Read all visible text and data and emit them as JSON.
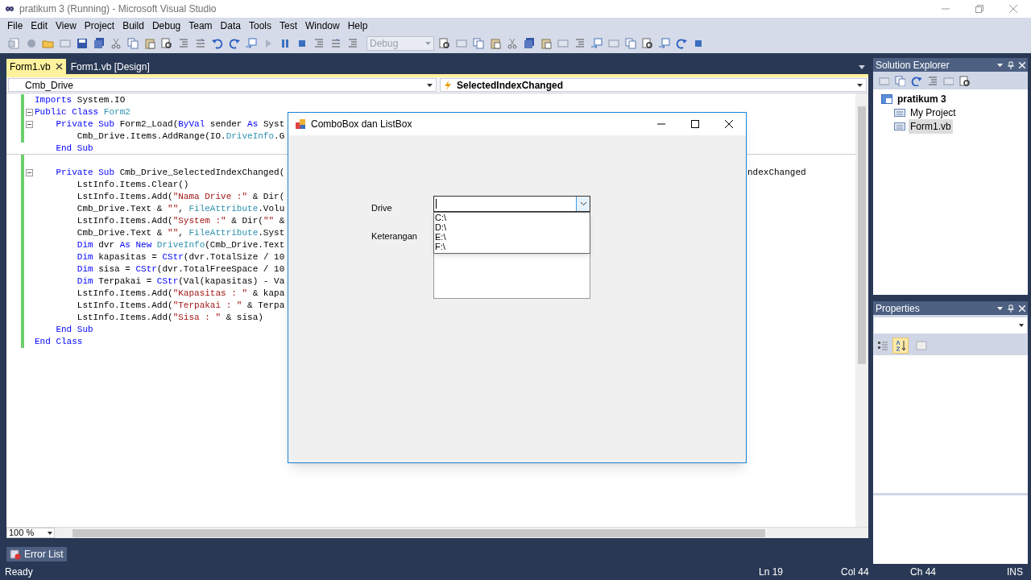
{
  "window": {
    "title": "pratikum 3 (Running) - Microsoft Visual Studio"
  },
  "menu": [
    "File",
    "Edit",
    "View",
    "Project",
    "Build",
    "Debug",
    "Team",
    "Data",
    "Tools",
    "Test",
    "Window",
    "Help"
  ],
  "toolbar": {
    "configuration": {
      "value": "Debug",
      "disabled": true
    }
  },
  "document_tabs": [
    {
      "label": "Form1.vb",
      "selected": true
    },
    {
      "label": "Form1.vb [Design]",
      "selected": false
    }
  ],
  "editor": {
    "object_selector": "Cmb_Drive",
    "event_selector": "SelectedIndexChanged",
    "zoom": "100 %",
    "lines": [
      {
        "changed": true,
        "segments": [
          {
            "kind": "keyword",
            "text": "Imports"
          },
          {
            "kind": "plain",
            "text": " System.IO"
          }
        ]
      },
      {
        "changed": true,
        "fold": true,
        "segments": [
          {
            "kind": "keyword",
            "text": "Public Class "
          },
          {
            "kind": "type",
            "text": "Form2"
          }
        ]
      },
      {
        "changed": true,
        "fold": true,
        "segments": [
          {
            "kind": "keyword",
            "text": "    Private Sub"
          },
          {
            "kind": "plain",
            "text": " Form2_Load("
          },
          {
            "kind": "keyword",
            "text": "ByVal"
          },
          {
            "kind": "plain",
            "text": " sender "
          },
          {
            "kind": "keyword",
            "text": "As"
          },
          {
            "kind": "plain",
            "text": " Syst"
          }
        ]
      },
      {
        "changed": true,
        "segments": [
          {
            "kind": "plain",
            "text": "        Cmb_Drive.Items.AddRange(IO."
          },
          {
            "kind": "type",
            "text": "DriveInfo"
          },
          {
            "kind": "plain",
            "text": ".G"
          }
        ]
      },
      {
        "changed": false,
        "segments": [
          {
            "kind": "keyword",
            "text": "    End Sub"
          }
        ]
      },
      {
        "changed": true
      },
      {
        "changed": true,
        "fold": true,
        "segments": [
          {
            "kind": "keyword",
            "text": "    Private Sub"
          },
          {
            "kind": "plain",
            "text": " Cmb_Drive_SelectedIndexChanged("
          }
        ],
        "tail": "ndexChanged"
      },
      {
        "changed": true,
        "segments": [
          {
            "kind": "plain",
            "text": "        LstInfo.Items.Clear()"
          }
        ]
      },
      {
        "changed": true,
        "segments": [
          {
            "kind": "plain",
            "text": "        LstInfo.Items.Add("
          },
          {
            "kind": "string",
            "text": "\"Nama Drive :\""
          },
          {
            "kind": "plain",
            "text": " & Dir("
          }
        ]
      },
      {
        "changed": true,
        "segments": [
          {
            "kind": "plain",
            "text": "        Cmb_Drive.Text & "
          },
          {
            "kind": "string",
            "text": "\"\""
          },
          {
            "kind": "plain",
            "text": ", "
          },
          {
            "kind": "type",
            "text": "FileAttribute"
          },
          {
            "kind": "plain",
            "text": ".Volu"
          }
        ]
      },
      {
        "changed": true,
        "segments": [
          {
            "kind": "plain",
            "text": "        LstInfo.Items.Add("
          },
          {
            "kind": "string",
            "text": "\"System :\""
          },
          {
            "kind": "plain",
            "text": " & Dir("
          },
          {
            "kind": "string",
            "text": "\"\""
          },
          {
            "kind": "plain",
            "text": " &"
          }
        ]
      },
      {
        "changed": true,
        "segments": [
          {
            "kind": "plain",
            "text": "        Cmb_Drive.Text & "
          },
          {
            "kind": "string",
            "text": "\"\""
          },
          {
            "kind": "plain",
            "text": ", "
          },
          {
            "kind": "type",
            "text": "FileAttribute"
          },
          {
            "kind": "plain",
            "text": ".Syst"
          }
        ]
      },
      {
        "changed": true,
        "segments": [
          {
            "kind": "keyword",
            "text": "        Dim"
          },
          {
            "kind": "plain",
            "text": " dvr "
          },
          {
            "kind": "keyword",
            "text": "As New"
          },
          {
            "kind": "type",
            "text": " DriveInfo"
          },
          {
            "kind": "plain",
            "text": "(Cmb_Drive.Text"
          }
        ]
      },
      {
        "changed": true,
        "segments": [
          {
            "kind": "keyword",
            "text": "        Dim"
          },
          {
            "kind": "plain",
            "text": " kapasitas = "
          },
          {
            "kind": "keyword",
            "text": "CStr"
          },
          {
            "kind": "plain",
            "text": "(dvr.TotalSize / 10"
          }
        ]
      },
      {
        "changed": true,
        "segments": [
          {
            "kind": "keyword",
            "text": "        Dim"
          },
          {
            "kind": "plain",
            "text": " sisa = "
          },
          {
            "kind": "keyword",
            "text": "CStr"
          },
          {
            "kind": "plain",
            "text": "(dvr.TotalFreeSpace / 10"
          }
        ]
      },
      {
        "changed": true,
        "segments": [
          {
            "kind": "keyword",
            "text": "        Dim"
          },
          {
            "kind": "plain",
            "text": " Terpakai = "
          },
          {
            "kind": "keyword",
            "text": "CStr"
          },
          {
            "kind": "plain",
            "text": "(Val(kapasitas) - Va"
          }
        ]
      },
      {
        "changed": true,
        "segments": [
          {
            "kind": "plain",
            "text": "        LstInfo.Items.Add("
          },
          {
            "kind": "string",
            "text": "\"Kapasitas : \""
          },
          {
            "kind": "plain",
            "text": " & kapa"
          }
        ]
      },
      {
        "changed": true,
        "segments": [
          {
            "kind": "plain",
            "text": "        LstInfo.Items.Add("
          },
          {
            "kind": "string",
            "text": "\"Terpakai : \""
          },
          {
            "kind": "plain",
            "text": " & Terpa"
          }
        ]
      },
      {
        "changed": true,
        "segments": [
          {
            "kind": "plain",
            "text": "        LstInfo.Items.Add("
          },
          {
            "kind": "string",
            "text": "\"Sisa : \""
          },
          {
            "kind": "plain",
            "text": " & sisa)"
          }
        ]
      },
      {
        "changed": true,
        "segments": [
          {
            "kind": "keyword",
            "text": "    End Sub"
          }
        ]
      },
      {
        "changed": true,
        "segments": [
          {
            "kind": "keyword",
            "text": "End Class"
          }
        ]
      }
    ]
  },
  "form_window": {
    "title": "ComboBox dan ListBox",
    "drive_label": "Drive",
    "info_label": "Keterangan",
    "drive_options": [
      "C:\\",
      "D:\\",
      "E:\\",
      "F:\\"
    ]
  },
  "solution_explorer": {
    "title": "Solution Explorer",
    "tree": [
      {
        "label": "pratikum 3",
        "selected": false,
        "children": [
          {
            "label": "My Project",
            "selected": false
          },
          {
            "label": "Form1.vb",
            "selected": true
          }
        ]
      }
    ]
  },
  "properties": {
    "title": "Properties"
  },
  "bottom_tabs": [
    "Error List"
  ],
  "status_bar": {
    "message": "Ready",
    "line": "Ln 19",
    "column": "Col 44",
    "char": "Ch 44",
    "mode": "INS"
  }
}
